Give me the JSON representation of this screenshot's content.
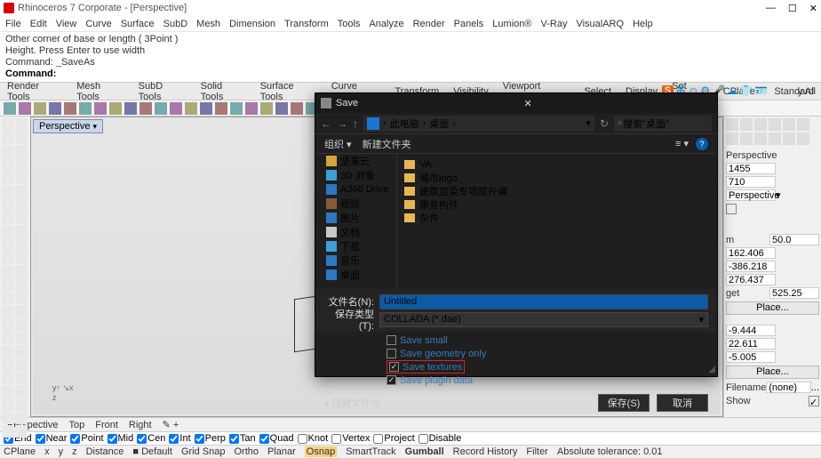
{
  "title": "Rhinoceros 7 Corporate - [Perspective]",
  "menu": [
    "File",
    "Edit",
    "View",
    "Curve",
    "Surface",
    "SubD",
    "Mesh",
    "Dimension",
    "Transform",
    "Tools",
    "Analyze",
    "Render",
    "Panels",
    "Lumion®",
    "V-Ray",
    "VisualARQ",
    "Help"
  ],
  "command_lines": [
    "Other corner of base or length ( 3Point )",
    "Height. Press Enter to use width",
    "Command: _SaveAs"
  ],
  "command_prompt": "Command:",
  "tabs": [
    "Standard",
    "CPlanes",
    "Set View",
    "Display",
    "Select",
    "Viewport Layout",
    "Visibility",
    "Transform",
    "Curve Tools",
    "Surface Tools",
    "Solid Tools",
    "SubD Tools",
    "Mesh Tools",
    "Render Tools"
  ],
  "ime_tail": "y All",
  "viewport": {
    "title": "Perspective"
  },
  "right": {
    "perspective": "Perspective",
    "v1": "1455",
    "v2": "710",
    "proj": "Perspective",
    "m": "m",
    "m_val": "50.0",
    "cx": "162.406",
    "cy": "-386.218",
    "cz": "276.437",
    "get": "get",
    "get_val": "525.25",
    "place": "Place...",
    "r1": "-9.444",
    "r2": "22.611",
    "r3": "-5.005",
    "filename_lbl": "Filename",
    "filename_val": "(none)",
    "show_lbl": "Show"
  },
  "viewtabs": [
    "Perspective",
    "Top",
    "Front",
    "Right"
  ],
  "osnaps": [
    "End",
    "Near",
    "Point",
    "Mid",
    "Cen",
    "Int",
    "Perp",
    "Tan",
    "Quad",
    "Knot",
    "Vertex",
    "Project",
    "Disable"
  ],
  "status": {
    "cplane": "CPlane",
    "x": "x",
    "y": "y",
    "z": "z",
    "distance": "Distance",
    "default": "■ Default",
    "gridsnap": "Grid Snap",
    "ortho": "Ortho",
    "planar": "Planar",
    "osnap": "Osnap",
    "smarttrack": "SmartTrack",
    "gumball": "Gumball",
    "record": "Record History",
    "filter": "Filter",
    "tol": "Absolute tolerance: 0.01"
  },
  "dialog": {
    "title": "Save",
    "breadcrumb": [
      "此电脑",
      "桌面"
    ],
    "refresh": "↻",
    "search_placeholder": "搜索\"桌面\"",
    "organize": "组织 ▾",
    "newfolder": "新建文件夹",
    "tree": [
      {
        "icon": "#d4a437",
        "label": "坚果云"
      },
      {
        "icon": "#3aa0d8",
        "label": "3D 对象"
      },
      {
        "icon": "#2b78c4",
        "label": "A360 Drive"
      },
      {
        "icon": "#8a5a3c",
        "label": "视频"
      },
      {
        "icon": "#2b78c4",
        "label": "图片"
      },
      {
        "icon": "#c9c9c9",
        "label": "文档"
      },
      {
        "icon": "#3aa0d8",
        "label": "下载"
      },
      {
        "icon": "#2b78c4",
        "label": "音乐"
      },
      {
        "icon": "#2b78c4",
        "label": "桌面"
      }
    ],
    "list": [
      "VA",
      "城市logo",
      "建筑渲染专项提升课",
      "康复构件",
      "杂件"
    ],
    "filename_lbl": "文件名(N):",
    "filename": "Untitled",
    "type_lbl": "保存类型(T):",
    "type": "COLLADA (*.dae)",
    "opts": [
      {
        "label": "Save small",
        "checked": false
      },
      {
        "label": "Save geometry only",
        "checked": false
      },
      {
        "label": "Save textures",
        "checked": true,
        "boxed": true
      },
      {
        "label": "Save plugin data",
        "checked": true
      }
    ],
    "hide": "▴ 隐藏文件夹",
    "save": "保存(S)",
    "cancel": "取消"
  }
}
